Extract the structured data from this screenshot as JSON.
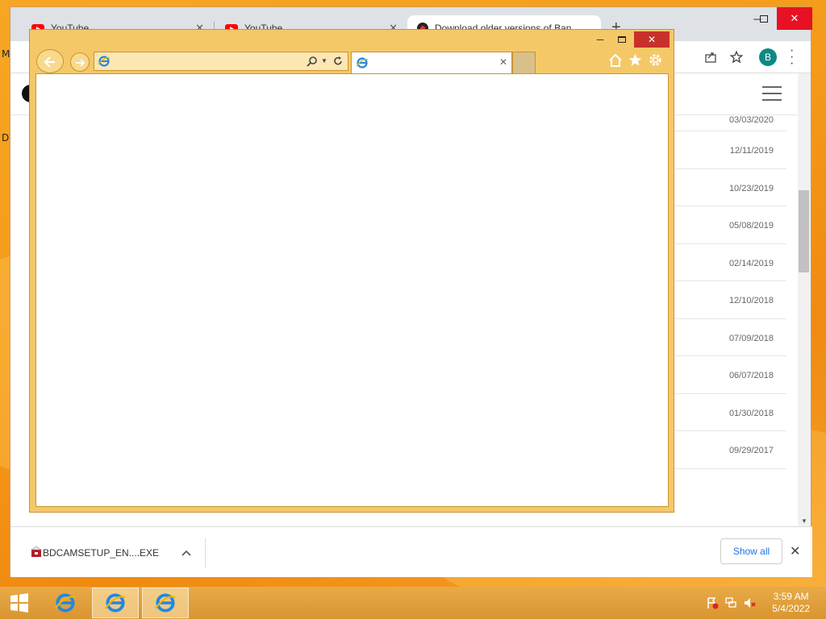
{
  "desktop": {
    "left_chars": [
      "M",
      "D"
    ]
  },
  "chrome": {
    "tabs": [
      {
        "title": "YouTube",
        "icon": "youtube-icon"
      },
      {
        "title": "YouTube",
        "icon": "youtube-icon"
      },
      {
        "title": "Download older versions of Ban",
        "icon": "site-favicon"
      }
    ],
    "new_tab_label": "+",
    "window": {
      "minimize": "─",
      "maximize": "□",
      "close": "✕"
    },
    "profile_initial": "B",
    "dates": [
      "03/03/2020",
      "12/11/2019",
      "10/23/2019",
      "05/08/2019",
      "02/14/2019",
      "12/10/2018",
      "07/09/2018",
      "06/07/2018",
      "01/30/2018",
      "09/29/2017"
    ],
    "download": {
      "file_name": "BDCAMSETUP_EN....EXE",
      "show_all": "Show all",
      "close": "✕"
    }
  },
  "ie": {
    "window": {
      "minimize": "─",
      "maximize": "□",
      "close": "✕"
    },
    "address_value": "",
    "tab_title": "",
    "tab_close": "✕"
  },
  "taskbar": {
    "time": "3:59 AM",
    "date": "5/4/2022"
  },
  "colors": {
    "accent_orange": "#f5a623",
    "ie_frame": "#f5c867",
    "chrome_close": "#e81123",
    "show_all_blue": "#1a73e8"
  }
}
